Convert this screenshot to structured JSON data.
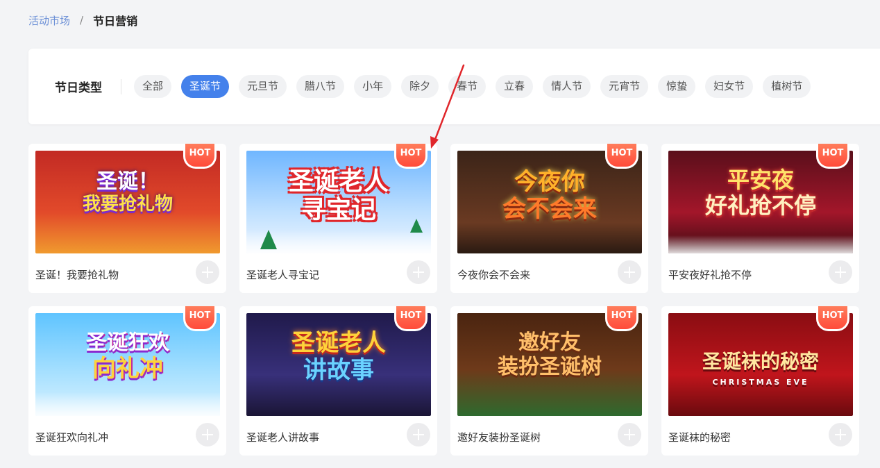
{
  "breadcrumb": {
    "parent": "活动市场",
    "separator": "/",
    "current": "节日营销"
  },
  "filter": {
    "title": "节日类型",
    "chips": [
      "全部",
      "圣诞节",
      "元旦节",
      "腊八节",
      "小年",
      "除夕",
      "春节",
      "立春",
      "情人节",
      "元宵节",
      "惊蛰",
      "妇女节",
      "植树节"
    ],
    "active": "圣诞节"
  },
  "badge": "HOT",
  "cards": [
    {
      "name": "圣诞！我要抢礼物",
      "art": [
        "圣诞！",
        "我要抢礼物"
      ]
    },
    {
      "name": "圣诞老人寻宝记",
      "art": [
        "圣诞老人",
        "寻宝记"
      ]
    },
    {
      "name": "今夜你会不会来",
      "art": [
        "今夜你",
        "会不会来"
      ]
    },
    {
      "name": "平安夜好礼抢不停",
      "art": [
        "平安夜",
        "好礼抢不停"
      ]
    },
    {
      "name": "圣诞狂欢向礼冲",
      "art": [
        "圣诞狂欢",
        "向礼冲"
      ]
    },
    {
      "name": "圣诞老人讲故事",
      "art": [
        "圣诞老人",
        "讲故事"
      ]
    },
    {
      "name": "邀好友装扮圣诞树",
      "art": [
        "邀好友",
        "装扮圣诞树"
      ]
    },
    {
      "name": "圣诞袜的秘密",
      "art": [
        "圣诞袜的秘密",
        "CHRISTMAS EVE"
      ]
    }
  ],
  "colors": {
    "accent": "#4481eb",
    "hot": "#ff5a3d",
    "annotation_arrow": "#e0262b"
  }
}
